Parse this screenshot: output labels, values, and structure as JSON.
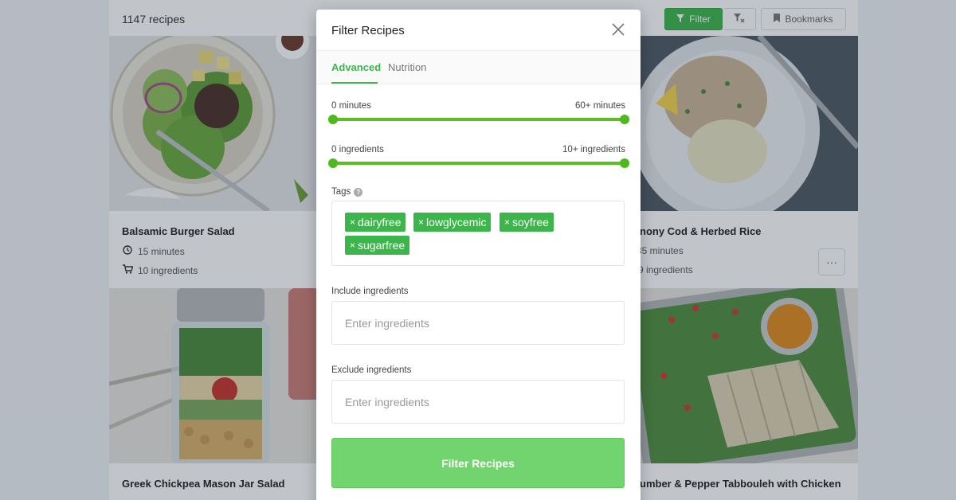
{
  "header": {
    "recipe_count": "1147 recipes",
    "filter_label": "Filter",
    "clear_label": "Tx",
    "bookmarks_label": "Bookmarks"
  },
  "cards": [
    {
      "title": "Balsamic Burger Salad",
      "time": "15 minutes",
      "ingredients": "10 ingredients"
    },
    {
      "title": "nony Cod & Herbed Rice",
      "time": "35 minutes",
      "ingredients": "9 ingredients"
    },
    {
      "title": "Greek Chickpea Mason Jar Salad"
    },
    {
      "title": "umber & Pepper Tabbouleh with Chicken"
    }
  ],
  "modal": {
    "title": "Filter Recipes",
    "tabs": [
      "Advanced",
      "Nutrition"
    ],
    "time_range": {
      "min_label": "0 minutes",
      "max_label": "60+ minutes"
    },
    "ingredient_range": {
      "min_label": "0 ingredients",
      "max_label": "10+ ingredients"
    },
    "tags_label": "Tags",
    "tags": [
      "dairyfree",
      "lowglycemic",
      "soyfree",
      "sugarfree"
    ],
    "include_label": "Include ingredients",
    "include_placeholder": "Enter ingredients",
    "exclude_label": "Exclude ingredients",
    "exclude_placeholder": "Enter ingredients",
    "submit_label": "Filter Recipes"
  },
  "colors": {
    "accent": "#3cb54a",
    "slider": "#5bbf21",
    "submit": "#72d46e"
  }
}
